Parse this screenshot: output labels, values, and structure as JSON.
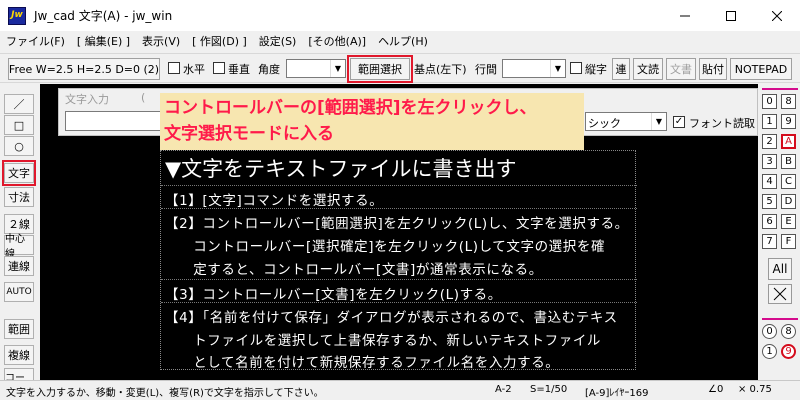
{
  "window": {
    "title": "Jw_cad 文字(A) - jw_win",
    "icon_text": "Jw"
  },
  "menu": [
    "ファイル(F)",
    "[ 編集(E) ]",
    "表示(V)",
    "[ 作図(D) ]",
    "設定(S)",
    "[その他(A)]",
    "ヘルプ(H)"
  ],
  "toolbar": {
    "font_button": "Free  W=2.5 H=2.5 D=0 (2)",
    "horizontal": "水平",
    "vertical": "垂直",
    "angle": "角度",
    "range_select": "範囲選択",
    "base_point": "基点(左下)",
    "line_spacing": "行間",
    "vertical_text": "縦字",
    "continuous": "連",
    "read_text": "文読",
    "write_text": "文書",
    "paste": "貼付",
    "notepad": "NOTEPAD"
  },
  "dialog": {
    "label": "文字入力",
    "paren": "(",
    "font_value": "シック",
    "font_read": "フォント読取"
  },
  "left_tools": [
    "／",
    "□",
    "○",
    "文字",
    "寸法",
    "２線",
    "中心線",
    "連線",
    "AUTO",
    "範囲",
    "複線",
    "コーナー"
  ],
  "right_tools": {
    "layer_groups": [
      "0",
      "1",
      "2",
      "3",
      "4",
      "5",
      "6",
      "7"
    ],
    "layers": [
      "8",
      "9",
      "A",
      "B",
      "C",
      "D",
      "E",
      "F"
    ],
    "all": "All",
    "bottom_left": [
      "0",
      "1"
    ],
    "bottom_right": [
      "8",
      "9"
    ]
  },
  "callout": [
    "コントロールバーの[範囲選択]を左クリックし、",
    "文字選択モードに入る"
  ],
  "document": {
    "title": "▼文字をテキストファイルに書き出す",
    "lines": [
      "【1】[文字]コマンドを選択する。",
      "【2】コントロールバー[範囲選択]を左クリック(L)し、文字を選択する。",
      "　　コントロールバー[選択確定]を左クリック(L)して文字の選択を確",
      "　　定すると、コントロールバー[文書]が通常表示になる。",
      "【3】コントロールバー[文書]を左クリック(L)する。",
      "【4】「名前を付けて保存」ダイアログが表示されるので、書込むテキス",
      "　　トファイルを選択して上書保存するか、新しいテキストファイル",
      "　　として名前を付けて新規保存するファイル名を入力する。"
    ]
  },
  "status": {
    "message": "文字を入力するか、移動・変更(L)、複写(R)で文字を指示して下さい。",
    "paper": "A-2",
    "scale": "S=1/50",
    "layer": "[A-9]ﾚｲﾔｰ169",
    "angle": "∠0",
    "zoom": "× 0.75"
  }
}
